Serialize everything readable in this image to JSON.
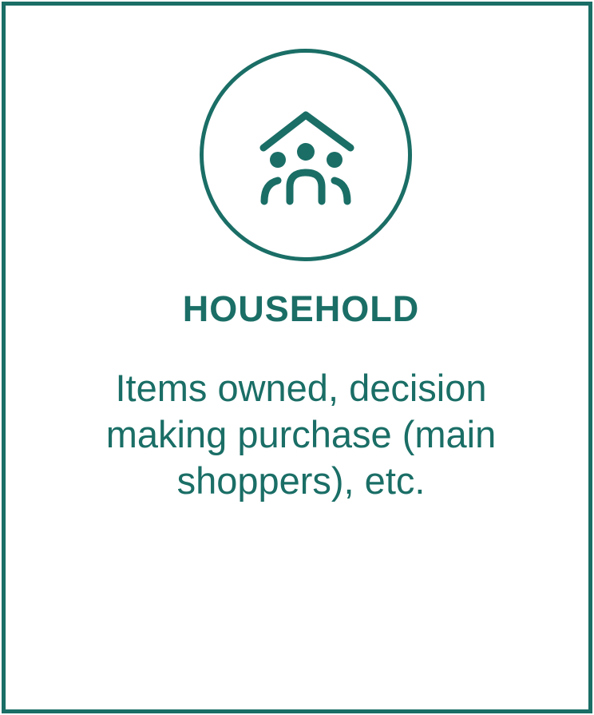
{
  "card": {
    "icon": "household-family-icon",
    "title": "HOUSEHOLD",
    "description_lines": [
      "Items owned, decision",
      "making purchase (main",
      "shoppers), etc."
    ]
  },
  "colors": {
    "accent": "#1a6e66",
    "background": "#ffffff"
  }
}
